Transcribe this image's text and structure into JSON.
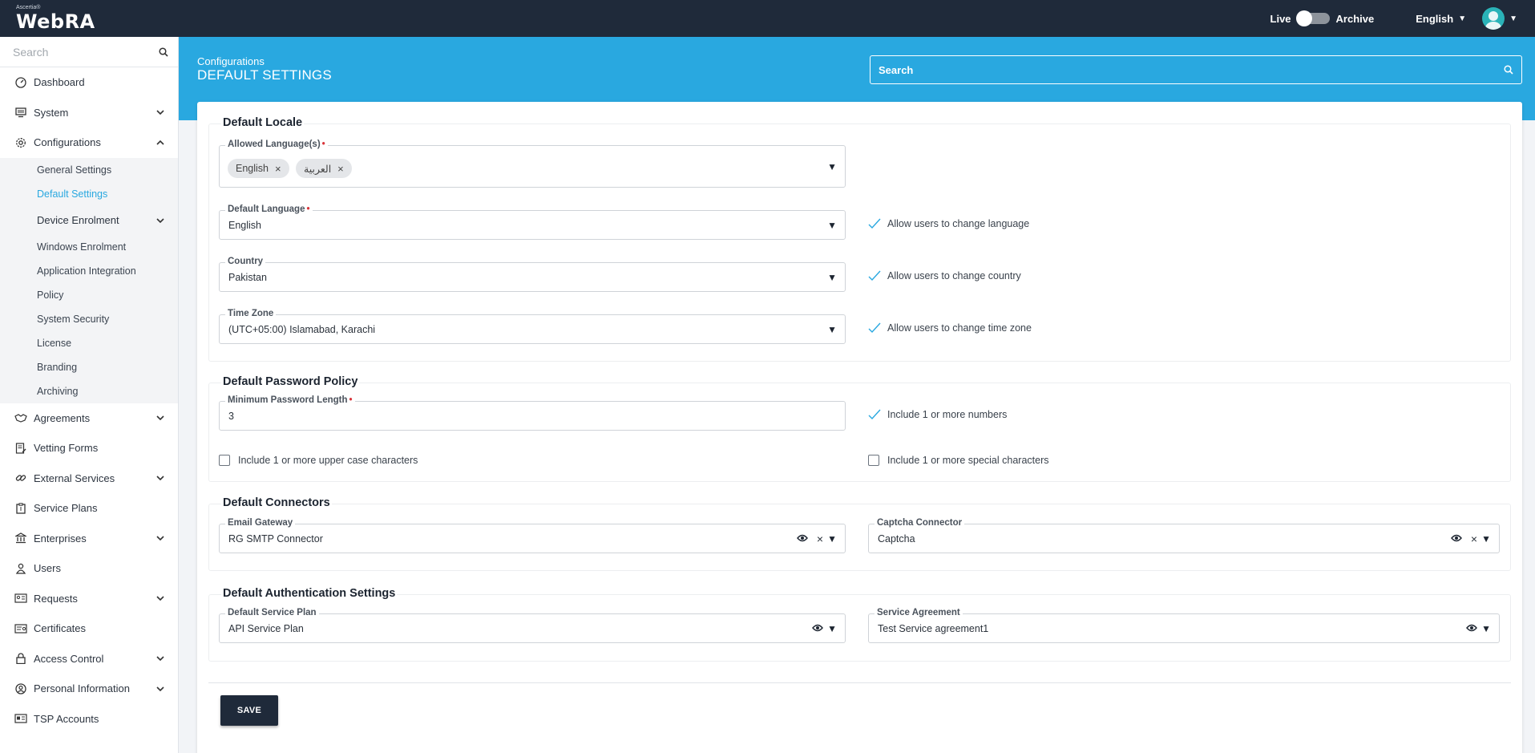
{
  "app": {
    "logo_small": "Ascertia®",
    "logo_big": "WebRA"
  },
  "topbar": {
    "live_label": "Live",
    "archive_label": "Archive",
    "language": "English"
  },
  "sidebar": {
    "search_placeholder": "Search",
    "items": {
      "dashboard": "Dashboard",
      "system": "System",
      "configurations": "Configurations",
      "agreements": "Agreements",
      "vetting_forms": "Vetting Forms",
      "external_services": "External Services",
      "service_plans": "Service Plans",
      "enterprises": "Enterprises",
      "users": "Users",
      "requests": "Requests",
      "certificates": "Certificates",
      "access_control": "Access Control",
      "personal_information": "Personal Information",
      "tsp_accounts": "TSP Accounts"
    },
    "sub": {
      "general_settings": "General Settings",
      "default_settings": "Default Settings",
      "device_enrolment": "Device Enrolment",
      "windows_enrolment": "Windows Enrolment",
      "application_integration": "Application Integration",
      "policy": "Policy",
      "system_security": "System Security",
      "license": "License",
      "branding": "Branding",
      "archiving": "Archiving"
    }
  },
  "header": {
    "breadcrumb": "Configurations",
    "title": "DEFAULT SETTINGS",
    "search_placeholder": "Search"
  },
  "locale": {
    "title": "Default Locale",
    "allowed_label": "Allowed Language(s)",
    "allowed_chips": [
      "English",
      "العربية"
    ],
    "default_lang_label": "Default Language",
    "default_lang_value": "English",
    "allow_change_language": "Allow users to change language",
    "country_label": "Country",
    "country_value": "Pakistan",
    "allow_change_country": "Allow users to change country",
    "timezone_label": "Time Zone",
    "timezone_value": "(UTC+05:00) Islamabad, Karachi",
    "allow_change_timezone": "Allow users to change time zone"
  },
  "password": {
    "title": "Default Password Policy",
    "min_length_label": "Minimum Password Length",
    "min_length_value": "3",
    "numbers": "Include 1 or more numbers",
    "upper": "Include 1 or more upper case characters",
    "special": "Include 1 or more special characters"
  },
  "connectors": {
    "title": "Default Connectors",
    "email_label": "Email Gateway",
    "email_value": "RG SMTP Connector",
    "captcha_label": "Captcha Connector",
    "captcha_value": "Captcha"
  },
  "auth": {
    "title": "Default Authentication Settings",
    "plan_label": "Default Service Plan",
    "plan_value": "API Service Plan",
    "agreement_label": "Service Agreement",
    "agreement_value": "Test Service agreement1"
  },
  "actions": {
    "save": "SAVE"
  },
  "colors": {
    "topbar": "#1f2a3a",
    "accent": "#29a8e0",
    "required": "#d9343a"
  }
}
